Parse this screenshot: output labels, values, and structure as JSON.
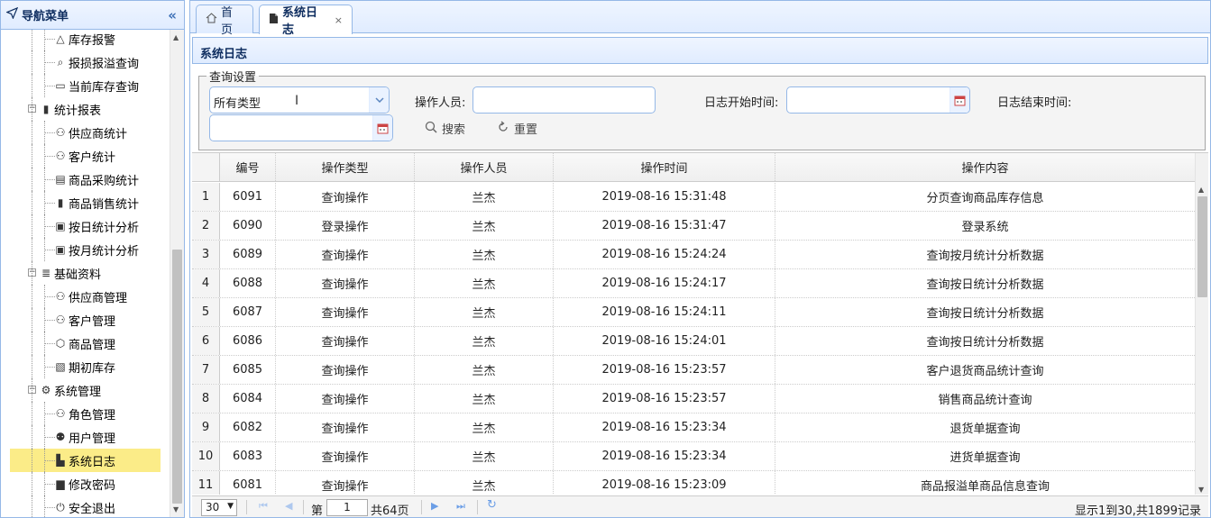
{
  "nav": {
    "title": "导航菜单",
    "items": [
      {
        "label": "库存报警",
        "icon": "bell-icon",
        "level": 2
      },
      {
        "label": "报损报溢查询",
        "icon": "search-icon",
        "level": 2
      },
      {
        "label": "当前库存查询",
        "icon": "grid-icon",
        "level": 2
      },
      {
        "label": "统计报表",
        "icon": "bar-chart-icon",
        "level": 1
      },
      {
        "label": "供应商统计",
        "icon": "person-icon",
        "level": 2
      },
      {
        "label": "客户统计",
        "icon": "people-icon",
        "level": 2
      },
      {
        "label": "商品采购统计",
        "icon": "document-icon",
        "level": 2
      },
      {
        "label": "商品销售统计",
        "icon": "bar-chart-icon",
        "level": 2
      },
      {
        "label": "按日统计分析",
        "icon": "calendar-day-icon",
        "level": 2
      },
      {
        "label": "按月统计分析",
        "icon": "calendar-month-icon",
        "level": 2
      },
      {
        "label": "基础资料",
        "icon": "list-icon",
        "level": 1
      },
      {
        "label": "供应商管理",
        "icon": "person-icon",
        "level": 2
      },
      {
        "label": "客户管理",
        "icon": "people-icon",
        "level": 2
      },
      {
        "label": "商品管理",
        "icon": "box-icon",
        "level": 2
      },
      {
        "label": "期初库存",
        "icon": "edit-icon",
        "level": 2
      },
      {
        "label": "系统管理",
        "icon": "gear-icon",
        "level": 1
      },
      {
        "label": "角色管理",
        "icon": "person-icon",
        "level": 2
      },
      {
        "label": "用户管理",
        "icon": "user-icon",
        "level": 2
      },
      {
        "label": "系统日志",
        "icon": "log-icon",
        "level": 2,
        "selected": true
      },
      {
        "label": "修改密码",
        "icon": "lock-icon",
        "level": 2
      },
      {
        "label": "安全退出",
        "icon": "power-icon",
        "level": 2
      }
    ]
  },
  "tabs": [
    {
      "label": "首页",
      "icon": "home-icon"
    },
    {
      "label": "系统日志",
      "icon": "log-icon",
      "closable": true
    }
  ],
  "panel": {
    "title": "系统日志"
  },
  "query": {
    "legend": "查询设置",
    "type_value": "所有类型",
    "user_label": "操作人员:",
    "start_label": "日志开始时间:",
    "end_label": "日志结束时间:",
    "search_label": "搜索",
    "reset_label": "重置"
  },
  "grid": {
    "columns": [
      "编号",
      "操作类型",
      "操作人员",
      "操作时间",
      "操作内容"
    ],
    "rows": [
      [
        "1",
        "6091",
        "查询操作",
        "兰杰",
        "2019-08-16 15:31:48",
        "分页查询商品库存信息"
      ],
      [
        "2",
        "6090",
        "登录操作",
        "兰杰",
        "2019-08-16 15:31:47",
        "登录系统"
      ],
      [
        "3",
        "6089",
        "查询操作",
        "兰杰",
        "2019-08-16 15:24:24",
        "查询按月统计分析数据"
      ],
      [
        "4",
        "6088",
        "查询操作",
        "兰杰",
        "2019-08-16 15:24:17",
        "查询按日统计分析数据"
      ],
      [
        "5",
        "6087",
        "查询操作",
        "兰杰",
        "2019-08-16 15:24:11",
        "查询按日统计分析数据"
      ],
      [
        "6",
        "6086",
        "查询操作",
        "兰杰",
        "2019-08-16 15:24:01",
        "查询按日统计分析数据"
      ],
      [
        "7",
        "6085",
        "查询操作",
        "兰杰",
        "2019-08-16 15:23:57",
        "客户退货商品统计查询"
      ],
      [
        "8",
        "6084",
        "查询操作",
        "兰杰",
        "2019-08-16 15:23:57",
        "销售商品统计查询"
      ],
      [
        "9",
        "6082",
        "查询操作",
        "兰杰",
        "2019-08-16 15:23:34",
        "退货单据查询"
      ],
      [
        "10",
        "6083",
        "查询操作",
        "兰杰",
        "2019-08-16 15:23:34",
        "进货单据查询"
      ],
      [
        "11",
        "6081",
        "查询操作",
        "兰杰",
        "2019-08-16 15:23:09",
        "商品报溢单商品信息查询"
      ]
    ]
  },
  "pager": {
    "page_size": "30",
    "page_prefix": "第",
    "page_value": "1",
    "page_suffix": "共64页",
    "info": "显示1到30,共1899记录"
  }
}
